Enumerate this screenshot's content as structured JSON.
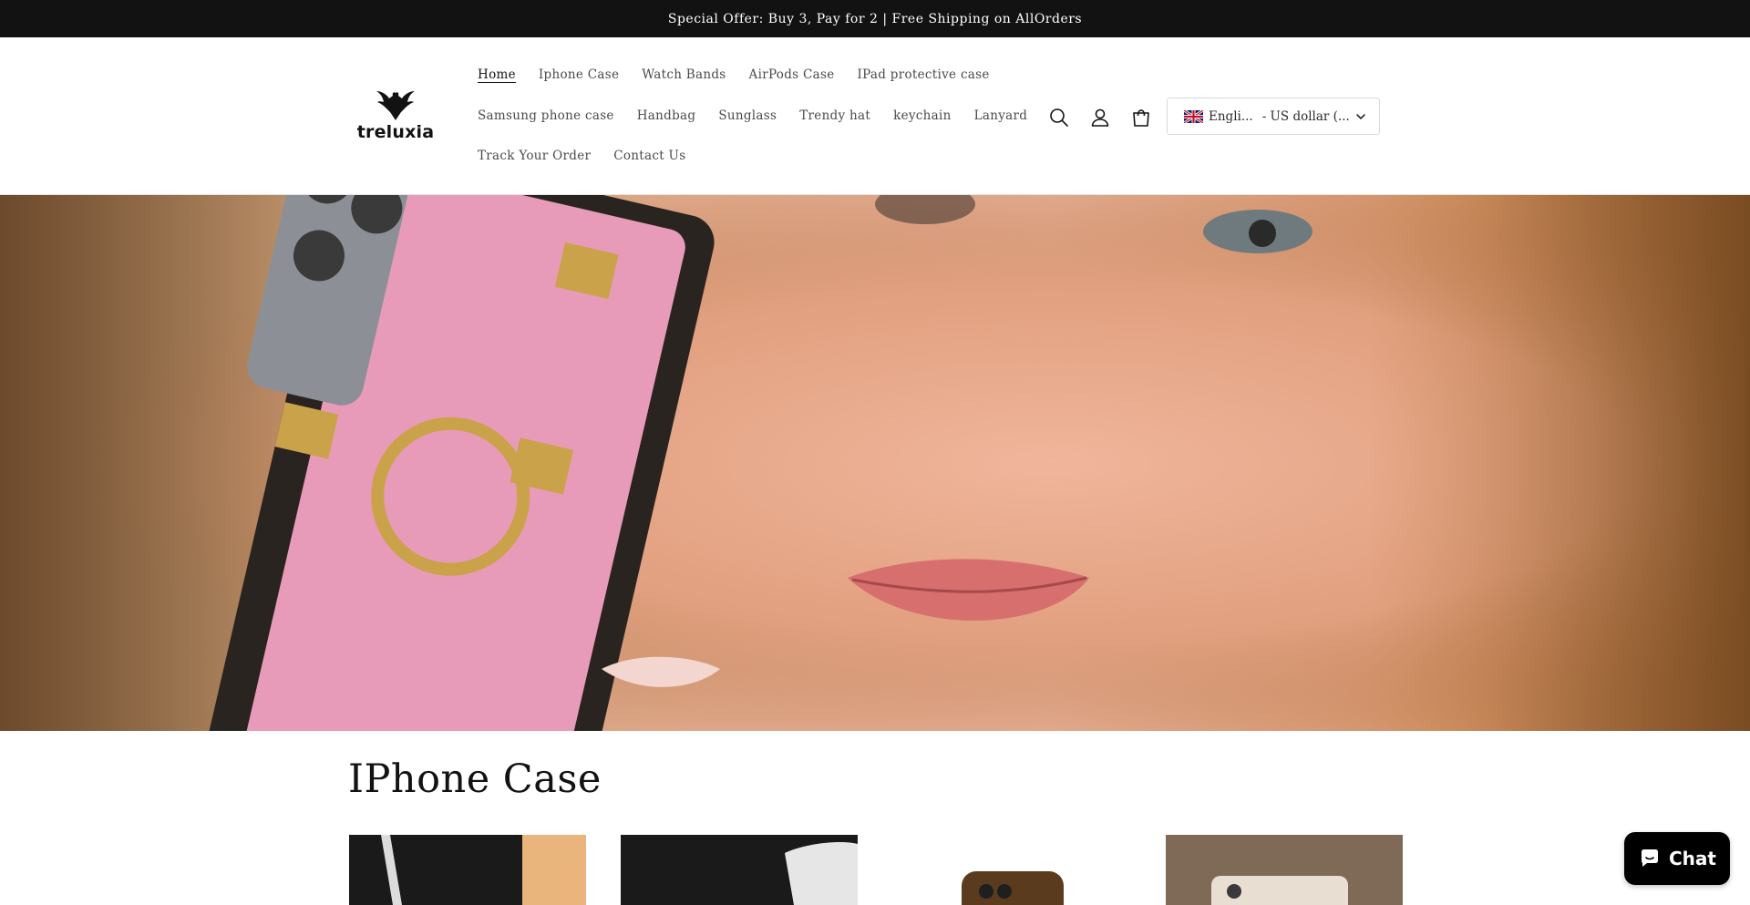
{
  "announcement": {
    "text": "Special Offer: Buy 3, Pay for 2 | Free Shipping on AllOrders"
  },
  "header": {
    "logo_text": "treluxia",
    "nav": [
      {
        "label": "Home",
        "active": true
      },
      {
        "label": "Iphone Case"
      },
      {
        "label": "Watch Bands"
      },
      {
        "label": "AirPods Case"
      },
      {
        "label": "IPad protective case"
      },
      {
        "label": "Samsung phone case"
      },
      {
        "label": "Handbag"
      },
      {
        "label": "Sunglass"
      },
      {
        "label": "Trendy hat"
      },
      {
        "label": "keychain"
      },
      {
        "label": "Lanyard"
      },
      {
        "label": "Track Your Order"
      },
      {
        "label": "Contact Us"
      }
    ],
    "icons": [
      "search-icon",
      "account-icon",
      "cart-icon"
    ],
    "locale": {
      "language": "Engli...",
      "currency": "- US dollar (...",
      "flag": "uk-flag-icon"
    }
  },
  "section": {
    "title": "IPhone Case"
  },
  "chat": {
    "label": "Chat"
  },
  "colors": {
    "announcement_bg": "#121212",
    "text": "#121212",
    "chat_bg": "#000000"
  }
}
